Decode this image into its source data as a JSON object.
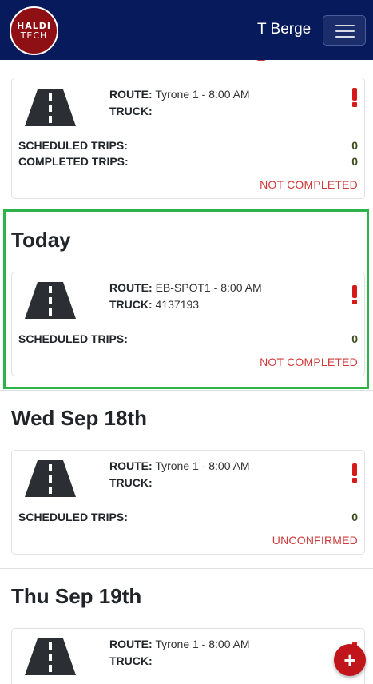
{
  "header": {
    "logo_top": "HALDI",
    "logo_bottom": "TECH",
    "user_name": "T Berge"
  },
  "labels": {
    "route": "ROUTE:",
    "truck": "TRUCK:",
    "scheduled_trips": "SCHEDULED TRIPS:",
    "completed_trips": "COMPLETED TRIPS:"
  },
  "cards": [
    {
      "route": "Tyrone 1 - 8:00 AM",
      "truck": "",
      "scheduled_trips": "0",
      "completed_trips": "0",
      "status": "NOT COMPLETED"
    },
    {
      "section": "Today",
      "route": "EB-SPOT1 - 8:00 AM",
      "truck": "4137193",
      "scheduled_trips": "0",
      "status": "NOT COMPLETED"
    },
    {
      "section": "Wed Sep 18th",
      "route": "Tyrone 1 - 8:00 AM",
      "truck": "",
      "scheduled_trips": "0",
      "status": "UNCONFIRMED"
    },
    {
      "section": "Thu Sep 19th",
      "route": "Tyrone 1 - 8:00 AM",
      "truck": ""
    }
  ],
  "fab": {
    "label": "+"
  },
  "colors": {
    "navbar": "#061a5c",
    "accent_red": "#d61a1a",
    "status_red": "#d03a3a",
    "highlight_green": "#2eb34a"
  },
  "icons": {
    "road": "road-icon",
    "alert": "exclamation-icon",
    "menu": "hamburger-menu-icon",
    "add": "plus-icon"
  }
}
